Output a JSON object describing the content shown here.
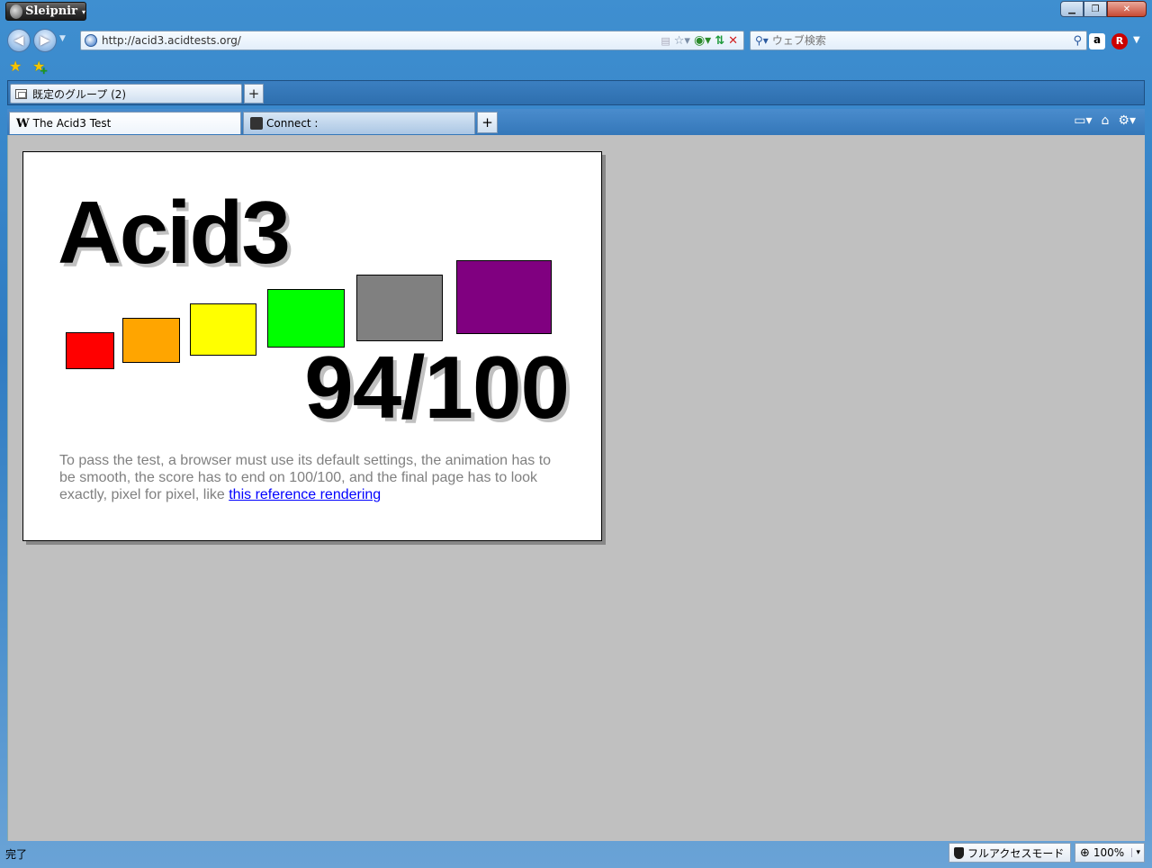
{
  "app": {
    "name": "Sleipnir"
  },
  "address": {
    "url": "http://acid3.acidtests.org/"
  },
  "search": {
    "placeholder": "ウェブ検索"
  },
  "group": {
    "label": "既定のグループ (2)"
  },
  "tabs": [
    {
      "label": "The Acid3 Test",
      "active": true
    },
    {
      "label": "Connect :",
      "active": false
    }
  ],
  "page": {
    "title": "Acid3",
    "score": "94/100",
    "text_before_link": "To pass the test, a browser must use its default settings, the animation has to be smooth, the score has to end on 100/100, and the final page has to look exactly, pixel for pixel, like ",
    "link_text": "this reference rendering",
    "bucket_colors": [
      "#ff0000",
      "#ffa500",
      "#ffff00",
      "#00ff00",
      "#808080",
      "#800080"
    ]
  },
  "status": {
    "text": "完了",
    "access_mode": "フルアクセスモード",
    "zoom": "100%"
  },
  "icons": [
    "back-icon",
    "forward-icon",
    "rss-icon",
    "star-icon",
    "go-icon",
    "reload-icon",
    "stop-icon",
    "search-icon",
    "amazon-icon",
    "rakuten-icon",
    "favorites-star-icon",
    "add-favorite-icon",
    "group-icon",
    "wikipedia-icon",
    "home-icon",
    "gear-icon",
    "shield-icon",
    "zoom-icon"
  ]
}
